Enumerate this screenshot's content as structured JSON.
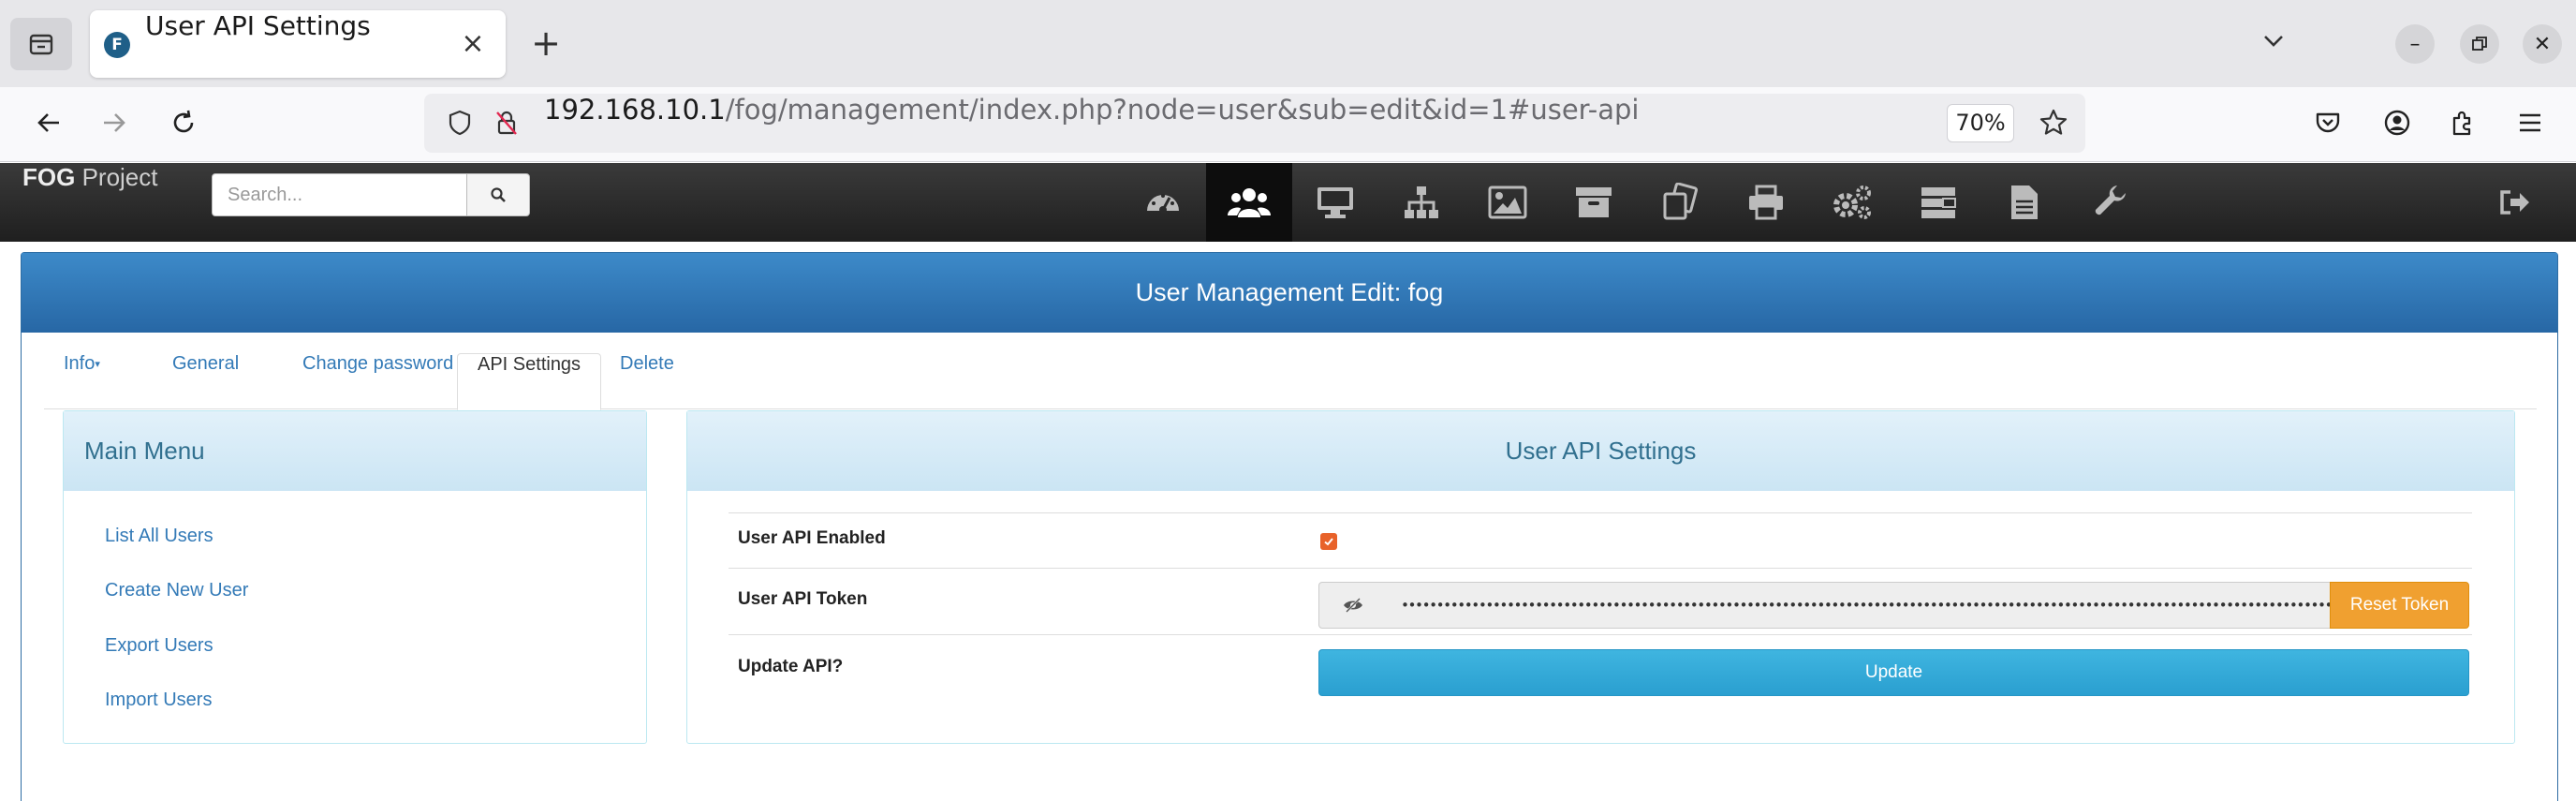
{
  "browser": {
    "tab_title": "User API Settings",
    "tab_favicon_letter": "F",
    "url_host": "192.168.10.1",
    "url_path": "/fog/management/index.php?node=user&sub=edit&id=1#user-api",
    "zoom": "70%"
  },
  "fog": {
    "brand_bold": "FOG",
    "brand_rest": " Project",
    "search_placeholder": "Search...",
    "nav_icons": [
      "dashboard-icon",
      "users-icon",
      "hosts-icon",
      "groups-icon",
      "images-icon",
      "storage-icon",
      "snapins-icon",
      "printers-icon",
      "service-config-icon",
      "tasks-icon",
      "reports-icon",
      "fog-config-icon"
    ],
    "active_nav": "users-icon"
  },
  "page": {
    "heading": "User Management Edit: fog",
    "tabs": [
      "Info",
      "General",
      "Change password",
      "API Settings",
      "Delete"
    ],
    "active_tab": "API Settings"
  },
  "main_menu": {
    "title": "Main Menu",
    "items": [
      "List All Users",
      "Create New User",
      "Export Users",
      "Import Users"
    ]
  },
  "api_settings": {
    "title": "User API Settings",
    "enabled_label": "User API Enabled",
    "enabled": true,
    "token_label": "User API Token",
    "token_masked": "•••••••••••••••••••••••••••••••••••••••••••••••••••••••••••••••••••••••••••••••••••••••••••••••••••••••••••••••••••••••••••••••••••••",
    "reset_label": "Reset Token",
    "update_label": "Update API?",
    "update_button": "Update"
  },
  "colors": {
    "panel_primary": "#2e6da4",
    "info_heading": "#31708f",
    "link": "#337ab7",
    "warning": "#f0a030",
    "update": "#3fb5e0",
    "checkbox": "#e8622a"
  }
}
